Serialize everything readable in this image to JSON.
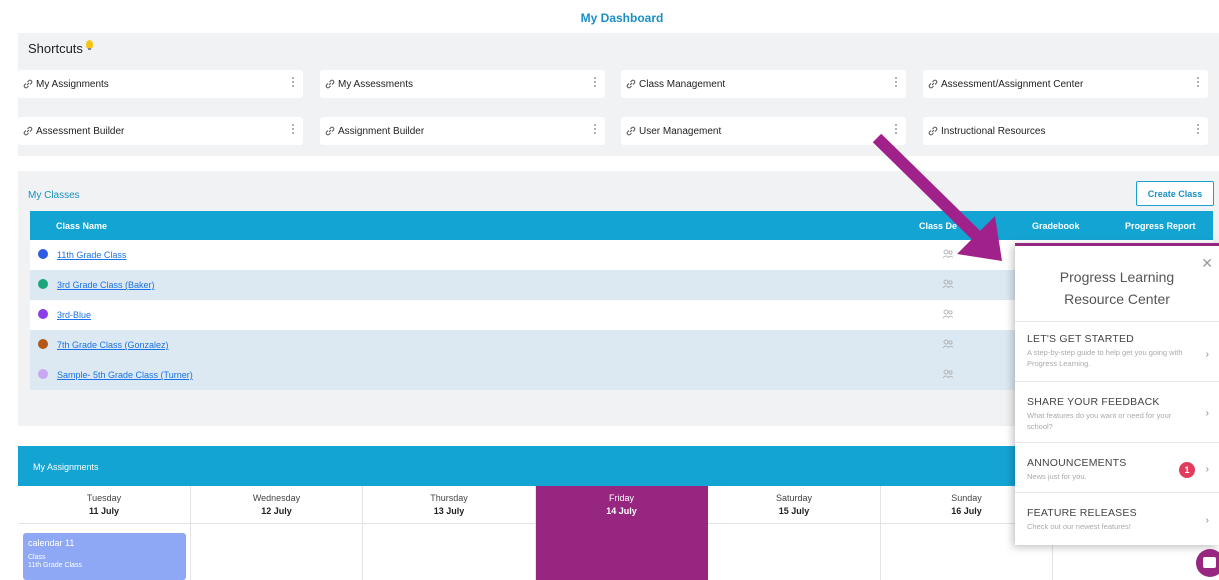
{
  "dashboard": {
    "title": "My Dashboard"
  },
  "shortcuts": {
    "title": "Shortcuts",
    "items": [
      {
        "label": "My Assignments"
      },
      {
        "label": "My Assessments"
      },
      {
        "label": "Class Management"
      },
      {
        "label": "Assessment/Assignment Center"
      },
      {
        "label": "Assessment Builder"
      },
      {
        "label": "Assignment Builder"
      },
      {
        "label": "User Management"
      },
      {
        "label": "Instructional Resources"
      }
    ]
  },
  "classes": {
    "title": "My Classes",
    "create_label": "Create Class",
    "columns": [
      "Class Name",
      "Class De",
      "Gradebook",
      "Progress Report"
    ],
    "rows": [
      {
        "name": "11th Grade Class",
        "color": "#2d5be3"
      },
      {
        "name": "3rd Grade Class (Baker)",
        "color": "#1aa67a"
      },
      {
        "name": "3rd-Blue",
        "color": "#8a3ee8"
      },
      {
        "name": "7th Grade Class (Gonzalez)",
        "color": "#b5561a"
      },
      {
        "name": "Sample- 5th Grade Class (Turner)",
        "color": "#c9a8f2"
      }
    ]
  },
  "assignments": {
    "title": "My Assignments",
    "days": [
      {
        "name": "Tuesday",
        "date": "11 July"
      },
      {
        "name": "Wednesday",
        "date": "12 July"
      },
      {
        "name": "Thursday",
        "date": "13 July"
      },
      {
        "name": "Friday",
        "date": "14 July"
      },
      {
        "name": "Saturday",
        "date": "15 July"
      },
      {
        "name": "Sunday",
        "date": "16 July"
      }
    ],
    "event": {
      "title": "calendar 11",
      "type": "Class",
      "class": "11th Grade Class"
    }
  },
  "resource_center": {
    "title_line1": "Progress Learning",
    "title_line2": "Resource Center",
    "items": [
      {
        "heading": "LET'S GET STARTED",
        "sub": "A step-by-step guide to help get you going with Progress Learning."
      },
      {
        "heading": "SHARE YOUR FEEDBACK",
        "sub": "What features do you want or need for your school?"
      },
      {
        "heading": "ANNOUNCEMENTS",
        "sub": "News just for you.",
        "badge": "1"
      },
      {
        "heading": "FEATURE RELEASES",
        "sub": "Check out our newest features!"
      }
    ]
  },
  "colors": {
    "accent": "#14a4d4",
    "highlight": "#96267f"
  }
}
